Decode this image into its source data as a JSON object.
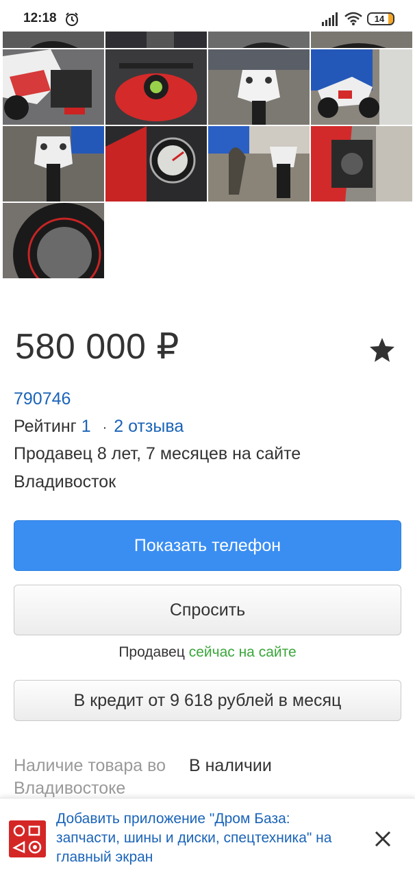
{
  "status_bar": {
    "time": "12:18",
    "battery": "14"
  },
  "listing": {
    "price": "580 000 ₽",
    "seller_id": "790746",
    "rating_label": "Рейтинг",
    "rating_value": "1",
    "rating_separator": "·",
    "reviews": "2 отзыва",
    "seller_since": "Продавец 8 лет, 7 месяцев на сайте",
    "city": "Владивосток"
  },
  "actions": {
    "show_phone": "Показать телефон",
    "ask": "Спросить",
    "seller_prefix": "Продавец",
    "seller_status": "сейчас на сайте",
    "credit": "В кредит от 9 618 рублей в месяц"
  },
  "availability": {
    "label": "Наличие товара во Владивостоке",
    "value": "В наличии"
  },
  "app_banner": {
    "text": "Добавить приложение \"Дром База: запчасти, шины и диски, спецтехника\" на главный экран"
  },
  "colors": {
    "link": "#1a63b8",
    "primary_button": "#3a8ef2",
    "online_green": "#3aa63a",
    "logo_red": "#d52626"
  }
}
